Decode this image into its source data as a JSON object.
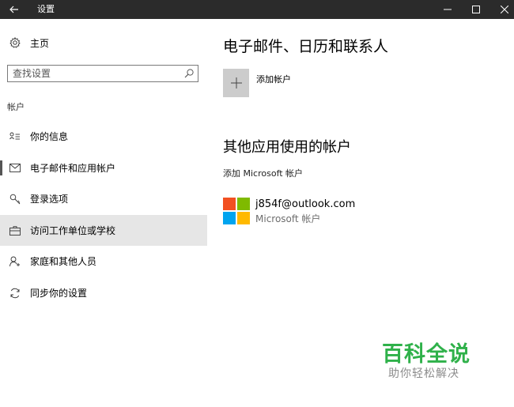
{
  "titlebar": {
    "back_icon": "arrow-left-icon",
    "title": "设置",
    "minimize": "–",
    "maximize": "☐",
    "close": "✕"
  },
  "sidebar": {
    "home_label": "主页",
    "search_placeholder": "查找设置",
    "section_label": "帐户",
    "items": [
      {
        "label": "你的信息",
        "icon": "person-list-icon"
      },
      {
        "label": "电子邮件和应用帐户",
        "icon": "mail-icon"
      },
      {
        "label": "登录选项",
        "icon": "key-icon"
      },
      {
        "label": "访问工作单位或学校",
        "icon": "briefcase-icon",
        "selected": true
      },
      {
        "label": "家庭和其他人员",
        "icon": "person-add-icon"
      },
      {
        "label": "同步你的设置",
        "icon": "sync-icon"
      }
    ]
  },
  "main": {
    "title": "电子邮件、日历和联系人",
    "add_account_label": "添加帐户",
    "section_title": "其他应用使用的帐户",
    "add_ms_account": "添加 Microsoft 帐户",
    "account": {
      "email": "j854f@outlook.com",
      "type": "Microsoft 帐户"
    }
  },
  "watermark": {
    "title": "百科全说",
    "subtitle": "助你轻松解决"
  },
  "colors": {
    "titlebar_bg": "#2b2b2b",
    "selected_bg": "#e6e6e6",
    "ms_red": "#f25022",
    "ms_green": "#7fba00",
    "ms_blue": "#00a4ef",
    "ms_yellow": "#ffb900",
    "watermark_green": "#2fb14a"
  }
}
